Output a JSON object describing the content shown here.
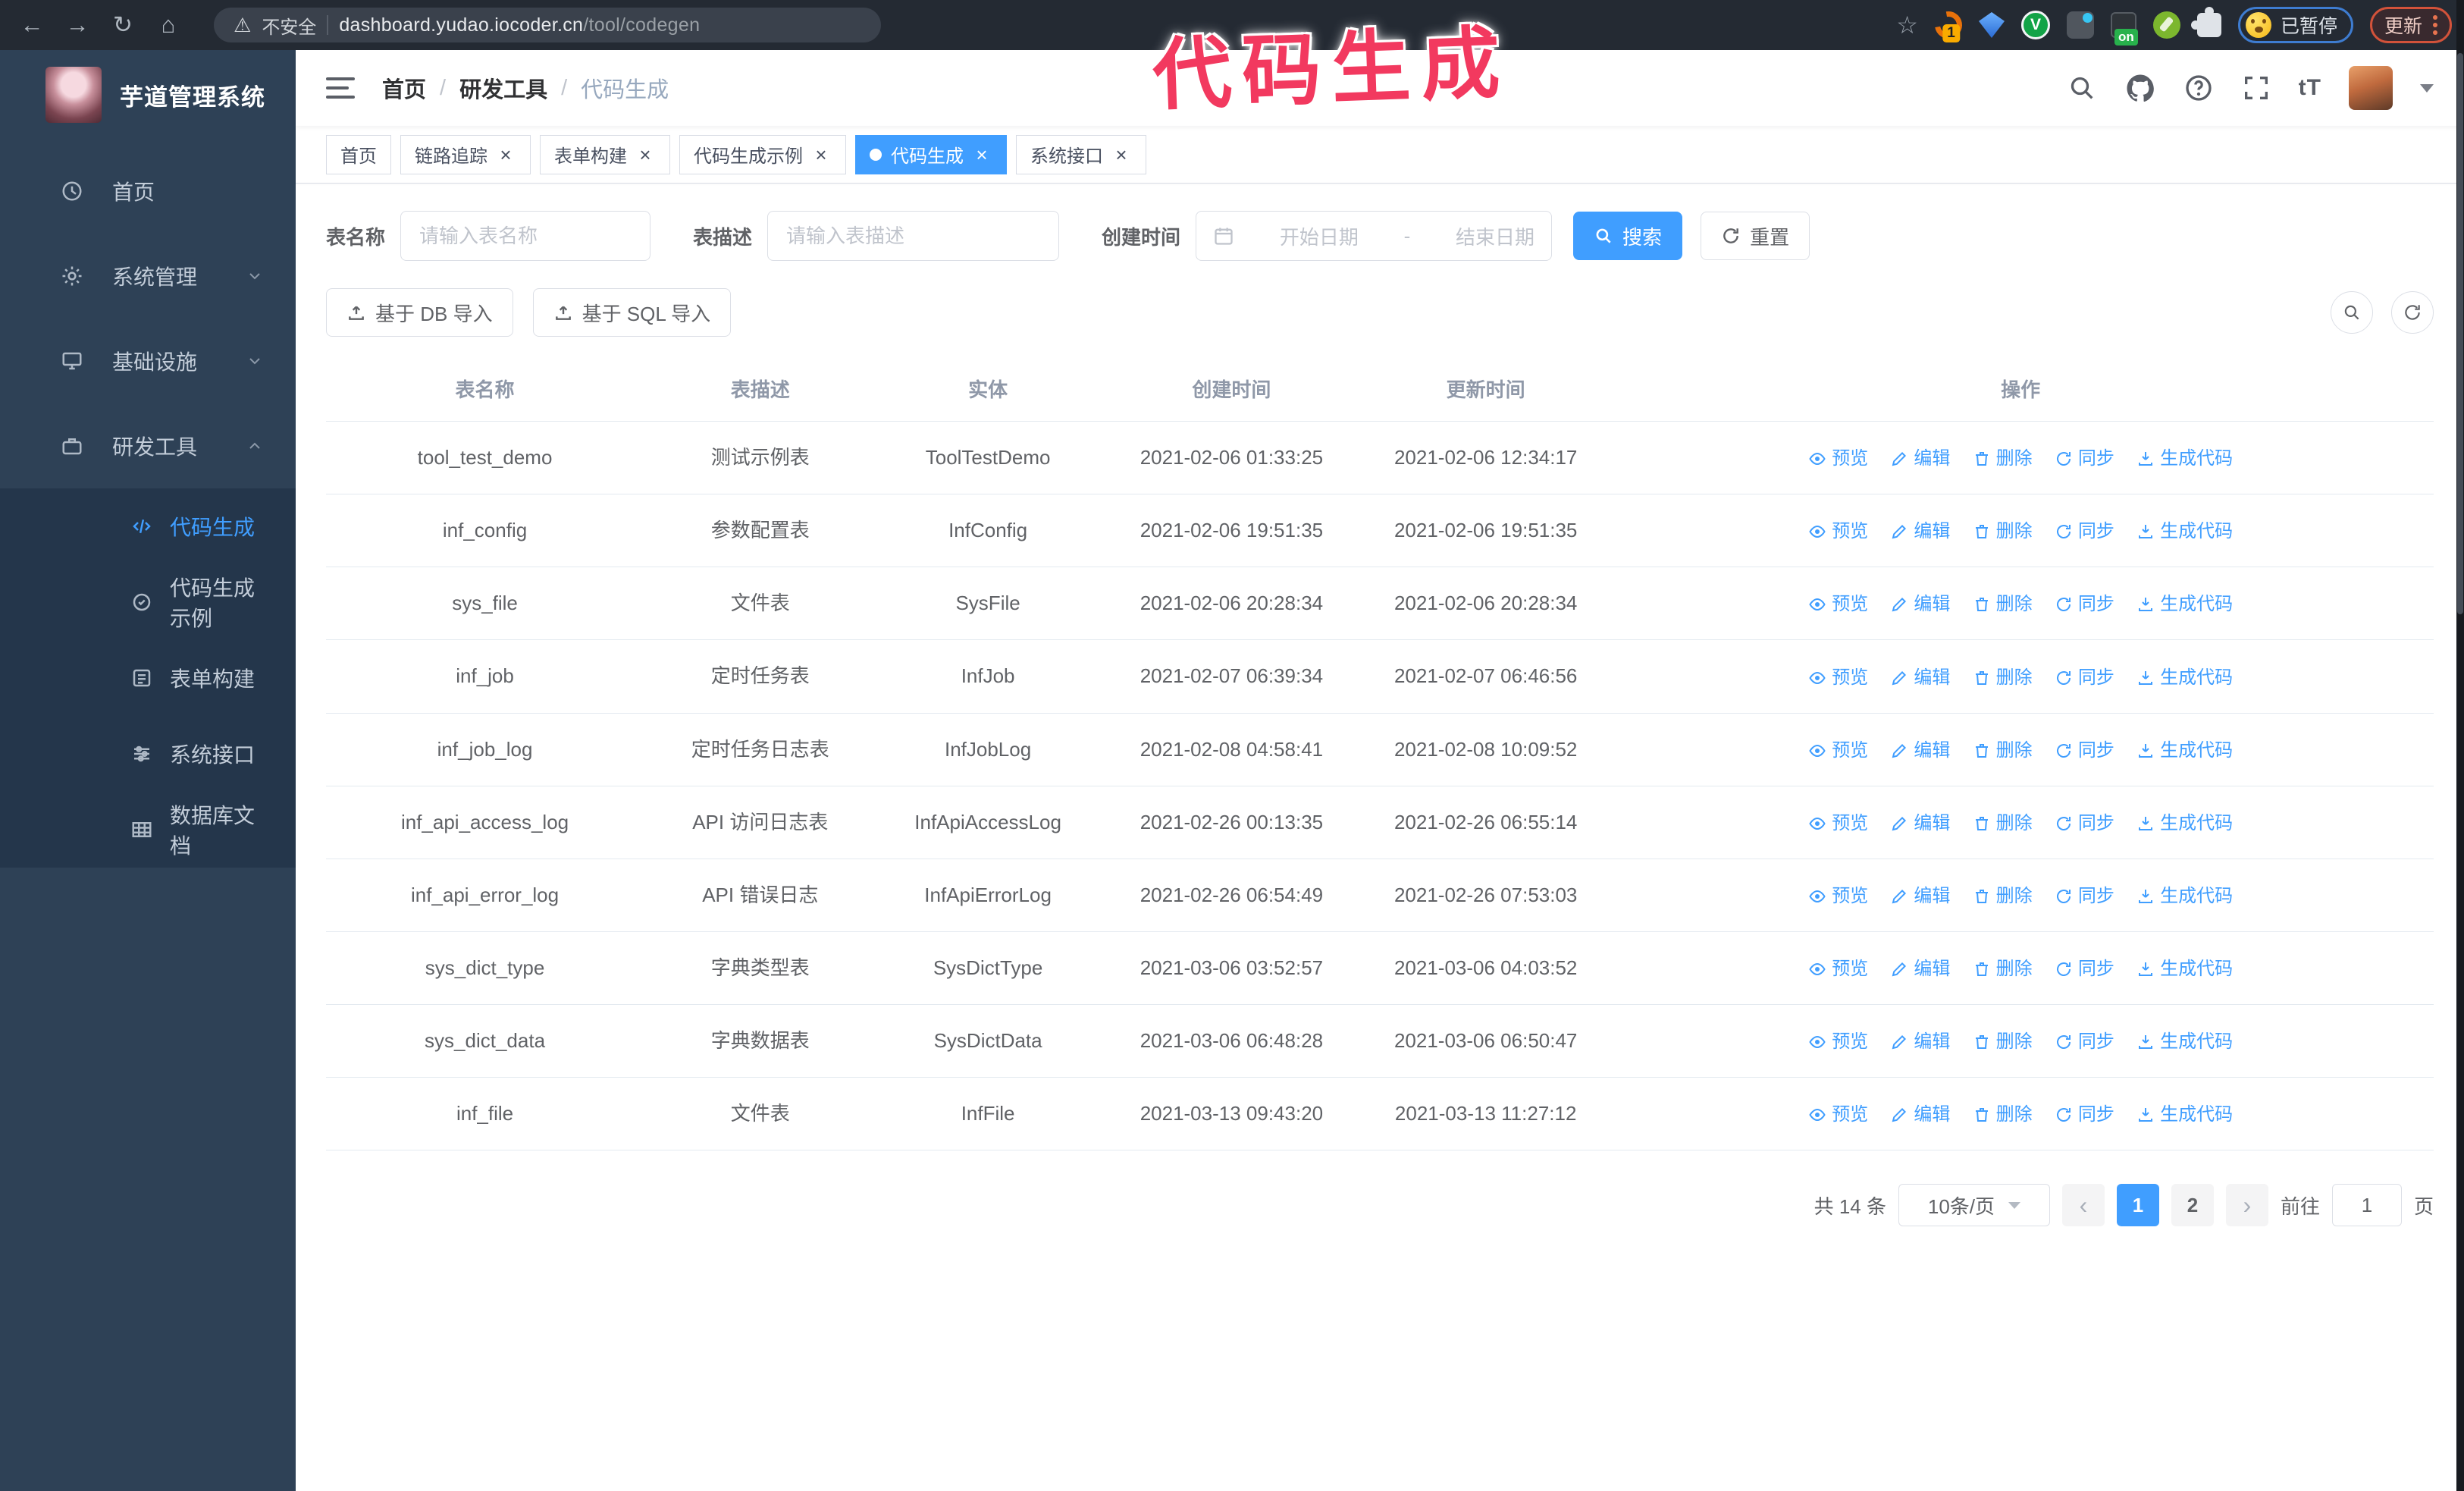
{
  "colors": {
    "accent": "#409eff",
    "annotation": "#f2395f",
    "chrome-bg": "#242a33",
    "sidebar-bg": "#2e4156",
    "submenu-bg": "#24364b"
  },
  "annotation": {
    "text": "代码生成"
  },
  "chrome": {
    "url_secure_label": "不安全",
    "url_host": "dashboard.yudao.iocoder.cn",
    "url_path": "/tool/codegen",
    "ext_badge": "1",
    "ext_on": "on",
    "paused_label": "已暂停",
    "update_label": "更新"
  },
  "sidebar": {
    "logo_title": "芋道管理系统",
    "items": [
      {
        "label": "首页"
      },
      {
        "label": "系统管理"
      },
      {
        "label": "基础设施"
      },
      {
        "label": "研发工具"
      }
    ],
    "sub_items": [
      {
        "label": "代码生成"
      },
      {
        "label": "代码生成示例"
      },
      {
        "label": "表单构建"
      },
      {
        "label": "系统接口"
      },
      {
        "label": "数据库文档"
      }
    ]
  },
  "navbar": {
    "breadcrumb": [
      "首页",
      "研发工具",
      "代码生成"
    ]
  },
  "tabs": [
    {
      "label": "首页"
    },
    {
      "label": "链路追踪"
    },
    {
      "label": "表单构建"
    },
    {
      "label": "代码生成示例"
    },
    {
      "label": "代码生成"
    },
    {
      "label": "系统接口"
    }
  ],
  "filters": {
    "name_label": "表名称",
    "name_placeholder": "请输入表名称",
    "desc_label": "表描述",
    "desc_placeholder": "请输入表描述",
    "date_label": "创建时间",
    "date_start": "开始日期",
    "date_separator": "-",
    "date_end": "结束日期",
    "search_label": "搜索",
    "reset_label": "重置"
  },
  "toolbar": {
    "db_import_label": "基于 DB 导入",
    "sql_import_label": "基于 SQL 导入"
  },
  "table": {
    "columns": [
      "表名称",
      "表描述",
      "实体",
      "创建时间",
      "更新时间",
      "操作"
    ],
    "actions": [
      {
        "icon": "eye-icon",
        "label": "预览"
      },
      {
        "icon": "edit-icon",
        "label": "编辑"
      },
      {
        "icon": "delete-icon",
        "label": "删除"
      },
      {
        "icon": "sync-icon",
        "label": "同步"
      },
      {
        "icon": "download-icon",
        "label": "生成代码"
      }
    ],
    "rows": [
      {
        "name": "tool_test_demo",
        "desc": "测试示例表",
        "entity": "ToolTestDemo",
        "created": "2021-02-06 01:33:25",
        "updated": "2021-02-06 12:34:17",
        "created_wrap": false,
        "updated_wrap": false
      },
      {
        "name": "inf_config",
        "desc": "参数配置表",
        "entity": "InfConfig",
        "created": "2021-02-06 19:51:35",
        "updated": "2021-02-06 19:51:35",
        "created_wrap": false,
        "updated_wrap": false
      },
      {
        "name": "sys_file",
        "desc": "文件表",
        "entity": "SysFile",
        "created": "2021-02-06 20:28:34",
        "updated": "2021-02-06 20:28:34",
        "created_wrap": true,
        "updated_wrap": true
      },
      {
        "name": "inf_job",
        "desc": "定时任务表",
        "entity": "InfJob",
        "created": "2021-02-07 06:39:34",
        "updated": "2021-02-07 06:46:56",
        "created_wrap": true,
        "updated_wrap": true
      },
      {
        "name": "inf_job_log",
        "desc": "定时任务日志表",
        "entity": "InfJobLog",
        "created": "2021-02-08 04:58:41",
        "updated": "2021-02-08 10:09:52",
        "created_wrap": true,
        "updated_wrap": true
      },
      {
        "name": "inf_api_access_log",
        "desc": "API 访问日志表",
        "entity": "InfApiAccessLog",
        "created": "2021-02-26 00:13:35",
        "updated": "2021-02-26 06:55:14",
        "created_wrap": false,
        "updated_wrap": true
      },
      {
        "name": "inf_api_error_log",
        "desc": "API 错误日志",
        "entity": "InfApiErrorLog",
        "created": "2021-02-26 06:54:49",
        "updated": "2021-02-26 07:53:03",
        "created_wrap": true,
        "updated_wrap": true
      },
      {
        "name": "sys_dict_type",
        "desc": "字典类型表",
        "entity": "SysDictType",
        "created": "2021-03-06 03:52:57",
        "updated": "2021-03-06 04:03:52",
        "created_wrap": true,
        "updated_wrap": true
      },
      {
        "name": "sys_dict_data",
        "desc": "字典数据表",
        "entity": "SysDictData",
        "created": "2021-03-06 06:48:28",
        "updated": "2021-03-06 06:50:47",
        "created_wrap": true,
        "updated_wrap": true
      },
      {
        "name": "inf_file",
        "desc": "文件表",
        "entity": "InfFile",
        "created": "2021-03-13 09:43:20",
        "updated": "2021-03-13 11:27:12",
        "created_wrap": true,
        "updated_wrap": false
      }
    ]
  },
  "pagination": {
    "total_label": "共 14 条",
    "page_size_label": "10条/页",
    "pages": [
      "1",
      "2"
    ],
    "active_page": "1",
    "goto_label": "前往",
    "goto_value": "1",
    "page_suffix": "页"
  }
}
